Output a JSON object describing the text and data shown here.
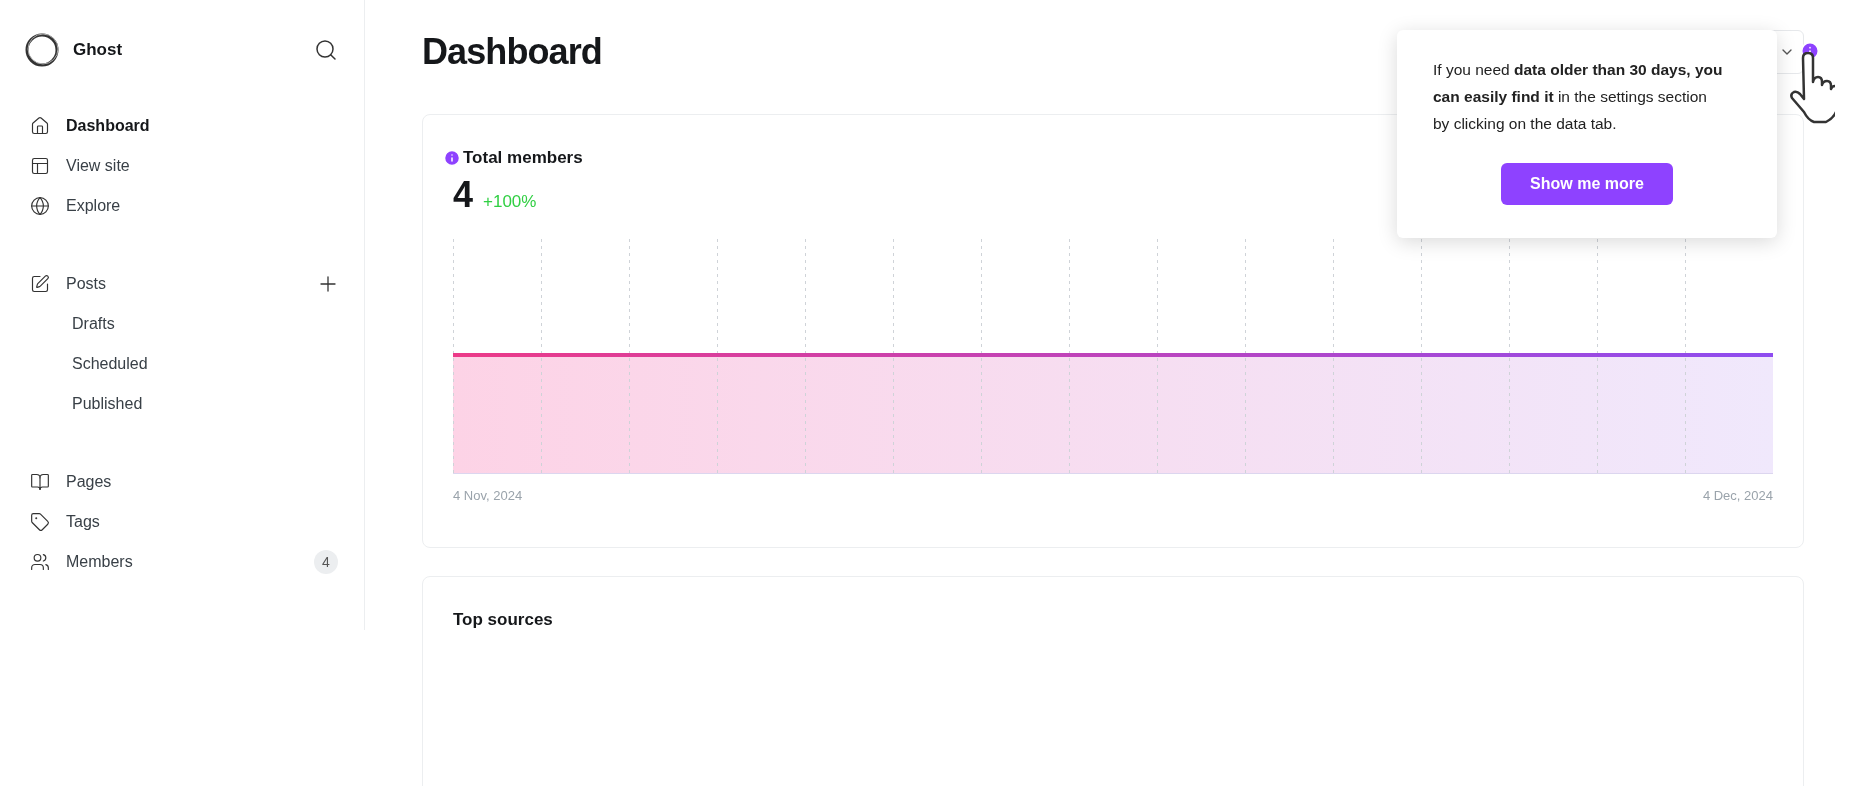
{
  "brand": {
    "name": "Ghost"
  },
  "sidebar": {
    "groups": [
      {
        "items": [
          {
            "label": "Dashboard",
            "selected": true
          },
          {
            "label": "View site",
            "selected": false
          },
          {
            "label": "Explore",
            "selected": false
          }
        ]
      },
      {
        "items": [
          {
            "label": "Posts",
            "selected": false,
            "children": [
              {
                "label": "Drafts",
                "selected": false
              },
              {
                "label": "Scheduled",
                "selected": false
              },
              {
                "label": "Published",
                "selected": false
              }
            ]
          }
        ]
      },
      {
        "items": [
          {
            "label": "Pages",
            "selected": false
          },
          {
            "label": "Tags",
            "selected": false
          },
          {
            "label": "Members",
            "selected": false,
            "badge": "4"
          }
        ]
      }
    ]
  },
  "page": {
    "title": "Dashboard"
  },
  "members_card": {
    "title": "Total members",
    "value": "4",
    "change": "+100%",
    "start_label": "4 Nov, 2024",
    "end_label": "4 Dec, 2024"
  },
  "sources_card": {
    "title": "Top sources"
  },
  "tooltip": {
    "text": "If you need **data older than 30 days, you can easily find it** in the settings section by clicking on the data tab.",
    "button": "Show me more"
  }
}
